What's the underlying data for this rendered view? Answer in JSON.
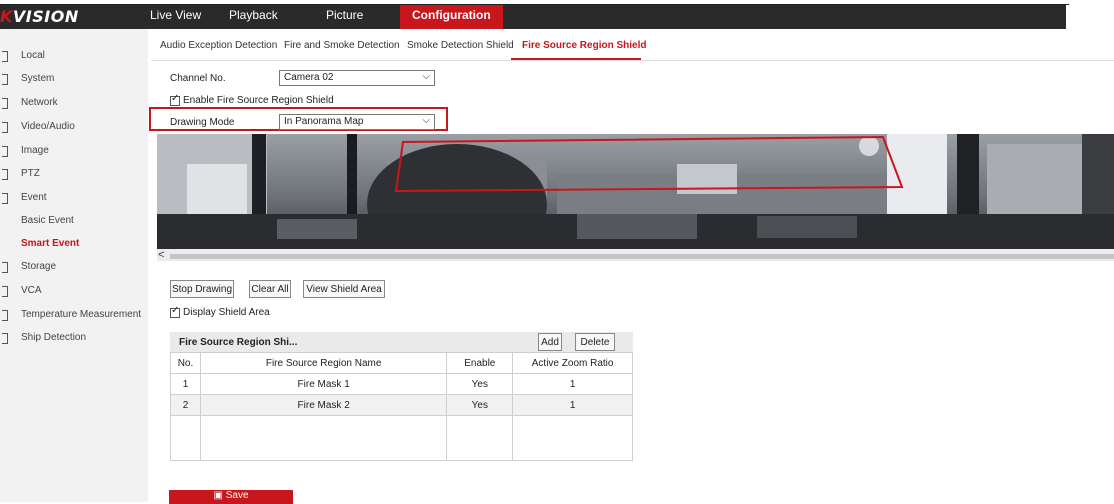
{
  "brand": {
    "logo_prefix": "K",
    "logo_text": "VISION"
  },
  "nav": {
    "items": [
      "Live View",
      "Playback",
      "Picture",
      "Configuration"
    ],
    "active": "Configuration"
  },
  "sidebar": {
    "items": [
      {
        "label": "Local"
      },
      {
        "label": "System"
      },
      {
        "label": "Network"
      },
      {
        "label": "Video/Audio"
      },
      {
        "label": "Image"
      },
      {
        "label": "PTZ"
      },
      {
        "label": "Event"
      },
      {
        "label": "Basic Event"
      },
      {
        "label": "Smart Event"
      },
      {
        "label": "Storage"
      },
      {
        "label": "VCA"
      },
      {
        "label": "Temperature Measurement"
      },
      {
        "label": "Ship Detection"
      }
    ]
  },
  "tabs": [
    "Audio Exception Detection",
    "Fire and Smoke Detection",
    "Smoke Detection Shield",
    "Fire Source Region Shield"
  ],
  "form": {
    "channel_label": "Channel No.",
    "channel_value": "Camera 02",
    "enable_label": "Enable Fire Source Region Shield",
    "drawing_mode_label": "Drawing Mode",
    "drawing_mode_value": "In Panorama Map"
  },
  "buttons": {
    "stop_drawing": "Stop Drawing",
    "clear_all": "Clear All",
    "view_shield": "View Shield Area",
    "add": "Add",
    "delete": "Delete",
    "save": "Save"
  },
  "display_shield_label": "Display Shield Area",
  "table": {
    "title": "Fire Source Region Shi...",
    "columns": [
      "No.",
      "Fire Source Region Name",
      "Enable",
      "Active Zoom Ratio"
    ],
    "rows": [
      [
        "1",
        "Fire Mask 1",
        "Yes",
        "1"
      ],
      [
        "2",
        "Fire Mask 2",
        "Yes",
        "1"
      ]
    ]
  },
  "colors": {
    "accent": "#c8161d",
    "topbar": "#2a2a2a",
    "sidebar": "#f2f2f2"
  }
}
